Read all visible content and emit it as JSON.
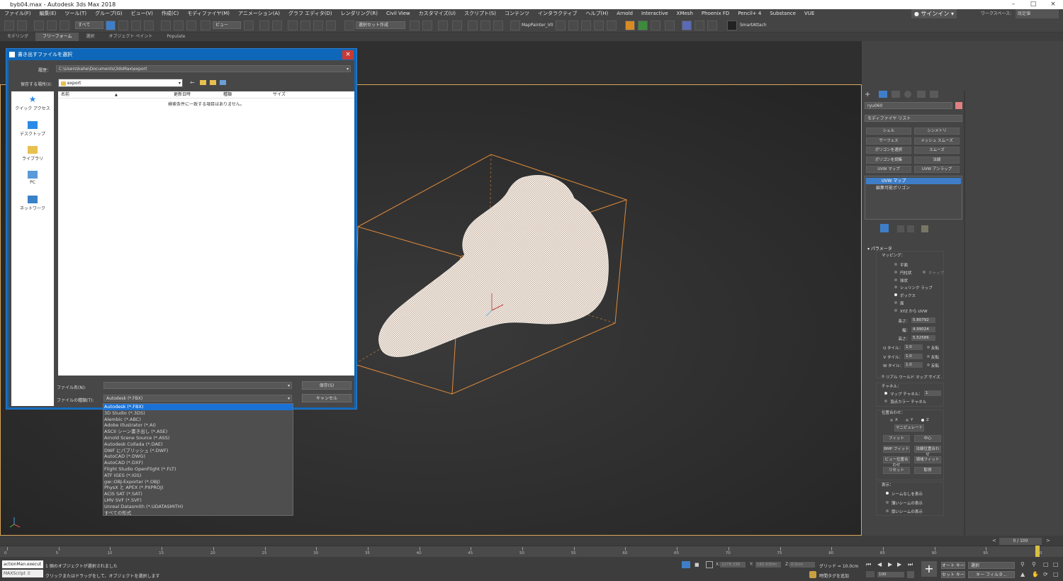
{
  "window": {
    "title": "byb04.max - Autodesk 3ds Max 2018"
  },
  "menu": [
    "ファイル(F)",
    "編集(E)",
    "ツール(T)",
    "グループ(G)",
    "ビュー(V)",
    "作成(C)",
    "モディファイヤ(M)",
    "アニメーション(A)",
    "グラフ エディタ(D)",
    "レンダリング(R)",
    "Civil View",
    "カスタマイズ(U)",
    "スクリプト(S)",
    "コンテンツ",
    "インタラクティブ",
    "ヘルプ(H)",
    "Arnold",
    "Interactive",
    "XMesh",
    "Phoenix FD",
    "Pencil+ 4",
    "Substance",
    "VUE"
  ],
  "signin": {
    "label": "サインイン"
  },
  "workspace": {
    "label": "ワークスペース:",
    "value": "既定値"
  },
  "toolbar": {
    "selection_filter": "すべて",
    "view_label": "ビュー",
    "selection_set": "選択セット作成",
    "mappainter": "MapPainter_V0",
    "smartattach": "SmartAttach"
  },
  "ribbon": [
    "モデリング",
    "フリーフォーム",
    "選択",
    "オブジェクト ペイント",
    "Populate"
  ],
  "dialog": {
    "title": "書き出すファイルを選択",
    "history_label": "履歴：",
    "history_value": "C:\\Users\\kahe\\Documents\\3dsMax\\export",
    "savein_label": "保存する場所(I):",
    "savein_value": "export",
    "places": [
      "クイック アクセス",
      "デスクトップ",
      "ライブラリ",
      "PC",
      "ネットワーク"
    ],
    "columns": [
      "名前",
      "更新日時",
      "種類",
      "サイズ"
    ],
    "empty_message": "検索条件に一致する項目はありません。",
    "filename_label": "ファイル名(N):",
    "filename_value": "",
    "filetype_label": "ファイルの種類(T):",
    "filetype_value": "Autodesk (*.FBX)",
    "save_button": "保存(S)",
    "cancel_button": "キャンセル"
  },
  "filetype_options": [
    "Autodesk (*.FBX)",
    "3D Studio (*.3DS)",
    "Alembic (*.ABC)",
    "Adobe Illustrator (*.AI)",
    "ASCII シーン書き出し (*.ASE)",
    "Arnold Scene Source (*.ASS)",
    "Autodesk Collada (*.DAE)",
    "DWF にパブリッシュ (*.DWF)",
    "AutoCAD (*.DWG)",
    "AutoCAD (*.DXF)",
    "Flight Studio OpenFlight (*.FLT)",
    "ATF IGES (*.IGS)",
    "gw::OBJ-Exporter (*.OBJ)",
    "PhysX と APEX (*.PXPROJ)",
    "ACIS SAT (*.SAT)",
    "LMV SVF (*.SVF)",
    "Unreal Datasmith (*.UDATASMITH)",
    "すべての形式"
  ],
  "command_panel": {
    "object_name": "ryu060",
    "modifier_list": "モディファイヤ リスト",
    "mod_buttons": [
      "シェル",
      "シンメトリ",
      "サーフェス",
      "メッシュ スムーズ",
      "ポリゴンを選択",
      "スムーズ",
      "ポリゴンを調集",
      "法線",
      "UVW マップ",
      "UVW アンラップ"
    ],
    "stack": [
      "UVW マップ",
      "編集可能ポリゴン"
    ],
    "rollout": "パラメータ",
    "mapping_label": "マッピング：",
    "mapping_options": [
      "平面",
      "円柱状",
      "球状",
      "シュリンク ラップ",
      "ボックス",
      "面",
      "XYZ から UVW"
    ],
    "cap_label": "キャップ",
    "dims": [
      {
        "label": "長さ：",
        "value": "5.80792"
      },
      {
        "label": "幅：",
        "value": "4.99024"
      },
      {
        "label": "高さ：",
        "value": "5.52586"
      }
    ],
    "tiles": [
      {
        "label": "U タイル：",
        "value": "1.0"
      },
      {
        "label": "V タイル：",
        "value": "1.0"
      },
      {
        "label": "W タイル：",
        "value": "1.0"
      }
    ],
    "flip_label": "反転",
    "realworld": "リアル ワールド マップ サイズ",
    "channel_label": "チャネル：",
    "map_channel": "マップ チャネル：",
    "map_channel_value": "1",
    "vcolor_channel": "頂点カラー チャネル",
    "align_label": "位置合わせ：",
    "axes": [
      "X",
      "Y",
      "Z"
    ],
    "manipulate": "マニピュレート",
    "align_buttons": [
      "フィット",
      "中心",
      "BMP フィット",
      "法線位置合わせ",
      "ビュー位置合わせ",
      "領域フィット",
      "リセット",
      "取得"
    ],
    "display_label": "表示：",
    "display_options": [
      "シームなしを表示",
      "薄いシームの表示",
      "厚いシームの表示"
    ]
  },
  "timeline": {
    "frame_display": "0 / 100",
    "status_objects": "1 個のオブジェクトが選択されました",
    "status_hint": "クリックまたはドラッグをして、オブジェクトを選択します",
    "listener": "actionMan.execut",
    "script_label": "MAXScript ミ",
    "coord_x": "2278.336",
    "coord_y": "182.630m",
    "coord_z": "0.0cm",
    "grid": "グリッド = 10.0cm",
    "time_tag": "時間タグを追加",
    "autokey": "オート キー",
    "setkey": "セット キー",
    "select_label": "選択",
    "keyfilter": "キー フィルタ...",
    "frame_num": "100"
  },
  "timeline_ticks": [
    "0",
    "5",
    "10",
    "15",
    "20",
    "25",
    "30",
    "35",
    "40",
    "45",
    "50",
    "55",
    "60",
    "65",
    "70",
    "75",
    "80",
    "85",
    "90",
    "95",
    "100"
  ]
}
